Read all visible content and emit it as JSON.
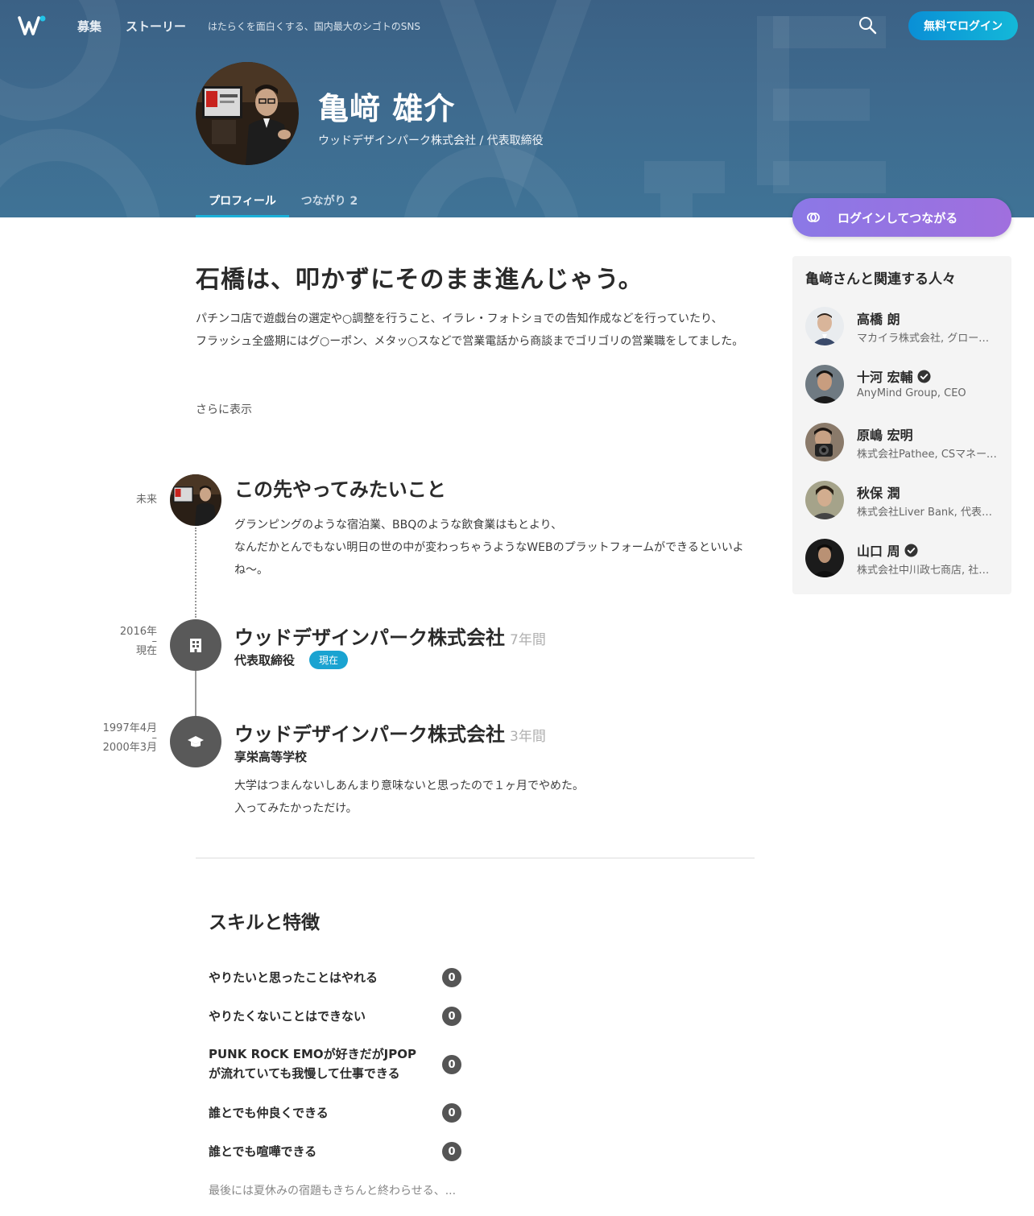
{
  "nav": {
    "recruit": "募集",
    "stories": "ストーリー",
    "tagline": "はたらくを面白くする、国内最大のシゴトのSNS",
    "login": "無料でログイン"
  },
  "profile": {
    "name": "亀﨑 雄介",
    "title": "ウッドデザインパーク株式会社 / 代表取締役",
    "tabs": {
      "profile": "プロフィール",
      "connections": "つながり 2"
    },
    "connect_button": "ログインしてつながる"
  },
  "about": {
    "headline": "石橋は、叩かずにそのまま進んじゃう。",
    "bio_line1": "パチンコ店で遊戯台の選定や○調整を行うこと、イラレ・フォトショでの告知作成などを行っていたり、",
    "bio_line2": "フラッシュ全盛期にはグ○ーポン、メタッ○スなどで営業電話から商談までゴリゴリの営業職をしてました。",
    "more": "さらに表示"
  },
  "timeline": {
    "future": {
      "date": "未来",
      "title": "この先やってみたいこと",
      "line1": "グランピングのような宿泊業、BBQのような飲食業はもとより、",
      "line2": "なんだかとんでもない明日の世の中が変わっちゃうようなWEBのプラットフォームができるといいよね〜。"
    },
    "job": {
      "date_start": "2016年",
      "dash": "–",
      "date_end": "現在",
      "title": "ウッドデザインパーク株式会社",
      "duration": "7年間",
      "role": "代表取締役",
      "badge": "現在"
    },
    "school": {
      "date_start": "1997年4月",
      "dash": "–",
      "date_end": "2000年3月",
      "title": "ウッドデザインパーク株式会社",
      "duration": "3年間",
      "role": "享栄高等学校",
      "line1": "大学はつまんないしあんまり意味ないと思ったので１ヶ月でやめた。",
      "line2": "入ってみたかっただけ。"
    }
  },
  "skills": {
    "title": "スキルと特徴",
    "items": [
      {
        "label": "やりたいと思ったことはやれる",
        "count": "0"
      },
      {
        "label": "やりたくないことはできない",
        "count": "0"
      },
      {
        "label": "PUNK ROCK EMOが好きだがJPOPが流れていても我慢して仕事できる",
        "count": "0"
      },
      {
        "label": "誰とでも仲良くできる",
        "count": "0"
      },
      {
        "label": "誰とでも喧嘩できる",
        "count": "0"
      }
    ],
    "more": "最後には夏休みの宿題もきちんと終わらせる、..."
  },
  "related": {
    "title": "亀﨑さんと関連する人々",
    "people": [
      {
        "name": "高橋 朗",
        "org": "マカイラ株式会社, グローバルディレクター"
      },
      {
        "name": "十河 宏輔",
        "org": "AnyMind Group, CEO"
      },
      {
        "name": "原嶋 宏明",
        "org": "株式会社Pathee, CSマネージャー"
      },
      {
        "name": "秋保 潤",
        "org": "株式会社Liver Bank, 代表取締役"
      },
      {
        "name": "山口 周",
        "org": "株式会社中川政七商店, 社外取締役"
      }
    ]
  },
  "colors": {
    "accent": "#1aa3d1",
    "hero": "#3e6a8e",
    "connect": "#9773e2"
  }
}
